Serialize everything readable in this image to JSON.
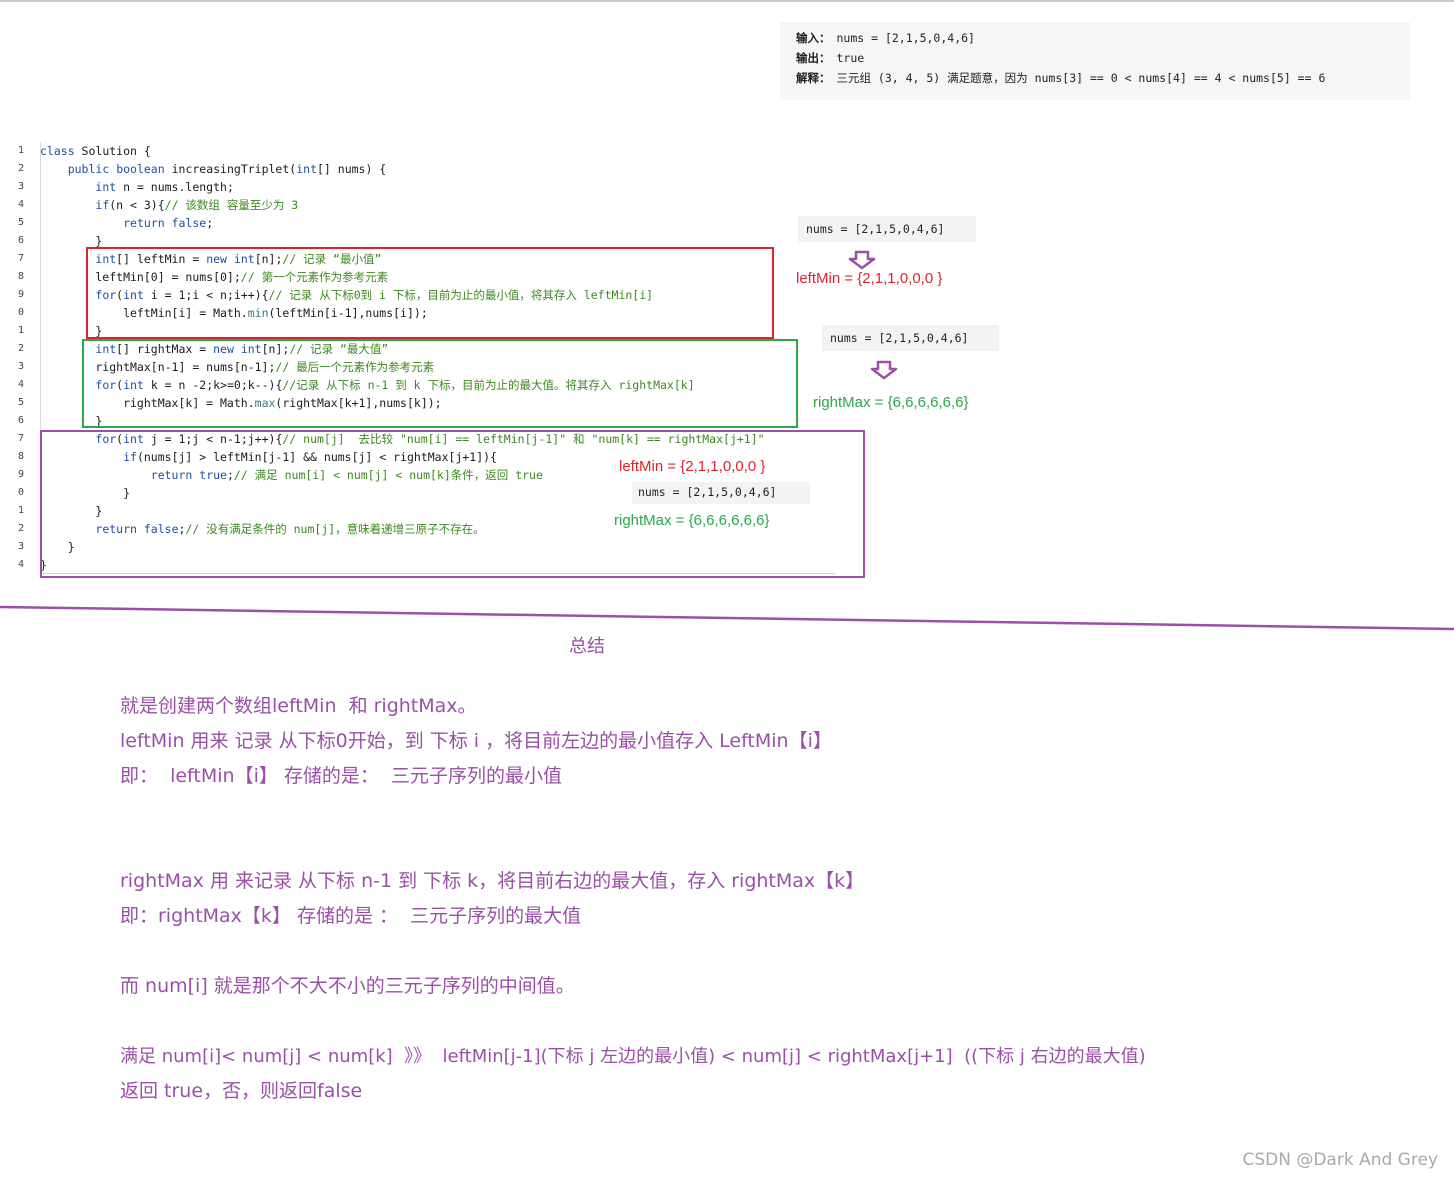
{
  "example": {
    "input_label": "输入：",
    "input_value": "nums = [2,1,5,0,4,6]",
    "output_label": "输出：",
    "output_value": "true",
    "explain_label": "解释：",
    "explain_value": "三元组 (3, 4, 5) 满足题意，因为 nums[3] == 0 < nums[4] == 4 < nums[5] == 6"
  },
  "code": {
    "line_numbers": [
      "1",
      "2",
      "3",
      "4",
      "5",
      "6",
      "7",
      "8",
      "9",
      "0",
      "1",
      "2",
      "3",
      "4",
      "5",
      "6",
      "7",
      "8",
      "9",
      "0",
      "1",
      "2",
      "3",
      "4"
    ],
    "lines": [
      "class Solution {",
      "    public boolean increasingTriplet(int[] nums) {",
      "        int n = nums.length;",
      "        if(n < 3){// 该数组 容量至少为 3",
      "            return false;",
      "        }",
      "        int[] leftMin = new int[n];// 记录 “最小值”",
      "        leftMin[0] = nums[0];// 第一个元素作为参考元素",
      "        for(int i = 1;i < n;i++){// 记录 从下标0到 i 下标，目前为止的最小值，将其存入 leftMin[i]",
      "            leftMin[i] = Math.min(leftMin[i-1],nums[i]);",
      "        }",
      "        int[] rightMax = new int[n];// 记录 “最大值”",
      "        rightMax[n-1] = nums[n-1];// 最后一个元素作为参考元素",
      "        for(int k = n -2;k>=0;k--){//记录 从下标 n-1 到 k 下标，目前为止的最大值。将其存入 rightMax[k]",
      "            rightMax[k] = Math.max(rightMax[k+1],nums[k]);",
      "        }",
      "        for(int j = 1;j < n-1;j++){// num[j]  去比较 \"num[i] == leftMin[j-1]\" 和 \"num[k] == rightMax[j+1]\"",
      "            if(nums[j] > leftMin[j-1] && nums[j] < rightMax[j+1]){",
      "                return true;// 满足 num[i] < num[j] < num[k]条件，返回 true",
      "            }",
      "        }",
      "        return false;// 没有满足条件的 num[j]，意味着递增三原子不存在。",
      "    }",
      "}"
    ]
  },
  "annotations": {
    "nums1": "nums = [2,1,5,0,4,6]",
    "leftMin1": "leftMin = {2,1,1,0,0,0 }",
    "nums2": "nums = [2,1,5,0,4,6]",
    "rightMax1": "rightMax = {6,6,6,6,6,6}",
    "leftMin2": "leftMin = {2,1,1,0,0,0 }",
    "nums3": "nums = [2,1,5,0,4,6]",
    "rightMax2": "rightMax = {6,6,6,6,6,6}"
  },
  "summary": {
    "title": "总结",
    "p1": "就是创建两个数组leftMin  和 rightMax。",
    "p2": "leftMin 用来 记录 从下标0开始，到 下标 i ，将目前左边的最小值存入 LeftMin【i】",
    "p3": "即：  leftMin【i】 存储的是：  三元子序列的最小值",
    "p4": "rightMax 用 来记录 从下标 n-1 到 下标 k，将目前右边的最大值，存入 rightMax【k】",
    "p5": "即：rightMax【k】 存储的是 ：  三元子序列的最大值",
    "p6": "而 num[i] 就是那个不大不小的三元子序列的中间值。",
    "p7": "满足 num[i]< num[j] < num[k]  》》  leftMin[j-1](下标 j 左边的最小值) < num[j] < rightMax[j+1]  ((下标 j 右边的最大值)",
    "p8": "返回 true，否，则返回false"
  },
  "watermark": "CSDN @Dark And Grey",
  "colors": {
    "red": "#e0232b",
    "green": "#2aa84a",
    "purple": "#9b4fa8"
  }
}
